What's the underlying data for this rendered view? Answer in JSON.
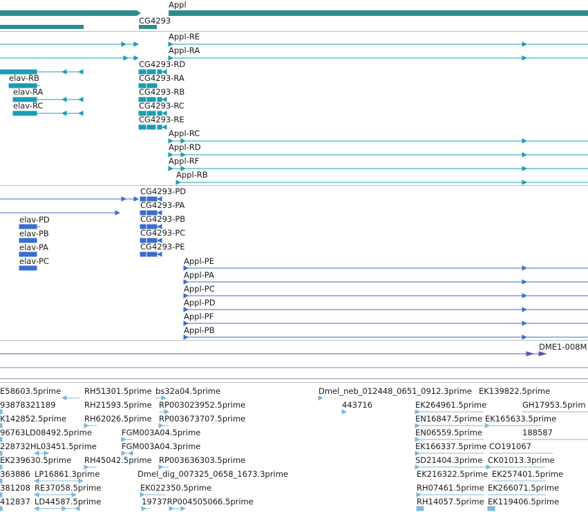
{
  "colors": {
    "gene": "#2e8b8b",
    "transcript": "#1a9db3",
    "protein": "#3a6ecc",
    "other": "#6a4fb0",
    "est": "#7fb8d9",
    "divider": "#bdbdbd"
  },
  "tracks": {
    "genes": [
      {
        "name": "Appl"
      },
      {
        "name": "CG4293"
      }
    ],
    "transcripts": [
      {
        "name": "Appl-RE"
      },
      {
        "name": "Appl-RA"
      },
      {
        "name": "CG4293-RD"
      },
      {
        "name": "elav-RB"
      },
      {
        "name": "CG4293-RA"
      },
      {
        "name": "elav-RA"
      },
      {
        "name": "CG4293-RB"
      },
      {
        "name": "elav-RC"
      },
      {
        "name": "CG4293-RC"
      },
      {
        "name": "CG4293-RE"
      },
      {
        "name": "Appl-RC"
      },
      {
        "name": "Appl-RD"
      },
      {
        "name": "Appl-RF"
      },
      {
        "name": "Appl-RB"
      }
    ],
    "proteins": [
      {
        "name": "CG4293-PD"
      },
      {
        "name": "CG4293-PA"
      },
      {
        "name": "elav-PD"
      },
      {
        "name": "CG4293-PB"
      },
      {
        "name": "elav-PB"
      },
      {
        "name": "CG4293-PC"
      },
      {
        "name": "elav-PA"
      },
      {
        "name": "CG4293-PE"
      },
      {
        "name": "elav-PC"
      },
      {
        "name": "Appl-PE"
      },
      {
        "name": "Appl-PA"
      },
      {
        "name": "Appl-PC"
      },
      {
        "name": "Appl-PD"
      },
      {
        "name": "Appl-PF"
      },
      {
        "name": "Appl-PB"
      }
    ],
    "other": [
      {
        "name": "DME1-008M"
      }
    ],
    "ests": [
      {
        "name": "E58603.5prime"
      },
      {
        "name": "RH51301.5prime"
      },
      {
        "name": "bs32a04.5prime"
      },
      {
        "name": "Dmel_neb_012448_0651_0912.3prime"
      },
      {
        "name": "EK139822.5prime"
      },
      {
        "name": "93878321189"
      },
      {
        "name": "RH21593.5prime"
      },
      {
        "name": "RP003023952.5prime"
      },
      {
        "name": "443716"
      },
      {
        "name": "EK264961.5prime"
      },
      {
        "name": "GH17953.5prim"
      },
      {
        "name": "K142852.5prime"
      },
      {
        "name": "RH62026.5prime"
      },
      {
        "name": "RP003673707.5prime"
      },
      {
        "name": "EN16847.5prime"
      },
      {
        "name": "EK165633.5prime"
      },
      {
        "name": "96763LD08492.5prime"
      },
      {
        "name": "FGM003A04.5prime"
      },
      {
        "name": "EN06559.5prime"
      },
      {
        "name": "188587"
      },
      {
        "name": "228732HL03451.5prime"
      },
      {
        "name": "FGM003A04.3prime"
      },
      {
        "name": "EK166337.5prime"
      },
      {
        "name": "CO191067"
      },
      {
        "name": "EK239630.5prime"
      },
      {
        "name": "RH45042.5prime"
      },
      {
        "name": "RP003636303.5prime"
      },
      {
        "name": "SD21404.3prime"
      },
      {
        "name": "CK01013.3prime"
      },
      {
        "name": "363886"
      },
      {
        "name": "LP16861.3prime"
      },
      {
        "name": "Dmel_dig_007325_0658_1673.3prime"
      },
      {
        "name": "EK216322.5prime"
      },
      {
        "name": "EK257401.5prime"
      },
      {
        "name": "381208"
      },
      {
        "name": "RE37058.5prime"
      },
      {
        "name": "EK022350.5prime"
      },
      {
        "name": "RH07461.5prime"
      },
      {
        "name": "EK266071.5prime"
      },
      {
        "name": "412837"
      },
      {
        "name": "LD44587.5prime"
      },
      {
        "name": "19737RP004505066.5prime"
      },
      {
        "name": "RH14057.5prime"
      },
      {
        "name": "EK119406.5prime"
      }
    ]
  }
}
